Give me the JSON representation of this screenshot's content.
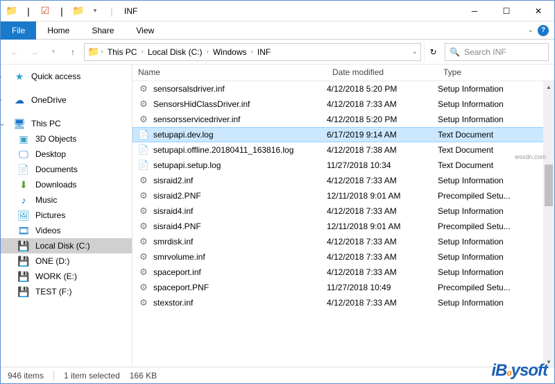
{
  "window": {
    "title": "INF",
    "separator": "|"
  },
  "ribbon": {
    "tabs": [
      "File",
      "Home",
      "Share",
      "View"
    ]
  },
  "breadcrumbs": [
    "This PC",
    "Local Disk (C:)",
    "Windows",
    "INF"
  ],
  "search": {
    "placeholder": "Search INF"
  },
  "sidebar": {
    "quick": "Quick access",
    "onedrive": "OneDrive",
    "thispc": "This PC",
    "items": [
      "3D Objects",
      "Desktop",
      "Documents",
      "Downloads",
      "Music",
      "Pictures",
      "Videos",
      "Local Disk (C:)",
      "ONE (D:)",
      "WORK (E:)",
      "TEST (F:)"
    ]
  },
  "columns": {
    "name": "Name",
    "date": "Date modified",
    "type": "Type"
  },
  "files": [
    {
      "name": "sensorsalsdriver.inf",
      "date": "4/12/2018 5:20 PM",
      "type": "Setup Information",
      "ico": "inf"
    },
    {
      "name": "SensorsHidClassDriver.inf",
      "date": "4/12/2018 7:33 AM",
      "type": "Setup Information",
      "ico": "inf"
    },
    {
      "name": "sensorsservicedriver.inf",
      "date": "4/12/2018 5:20 PM",
      "type": "Setup Information",
      "ico": "inf"
    },
    {
      "name": "setupapi.dev.log",
      "date": "6/17/2019 9:14 AM",
      "type": "Text Document",
      "ico": "log",
      "selected": true
    },
    {
      "name": "setupapi.offline.20180411_163816.log",
      "date": "4/12/2018 7:38 AM",
      "type": "Text Document",
      "ico": "log"
    },
    {
      "name": "setupapi.setup.log",
      "date": "11/27/2018 10:34",
      "type": "Text Document",
      "ico": "log"
    },
    {
      "name": "sisraid2.inf",
      "date": "4/12/2018 7:33 AM",
      "type": "Setup Information",
      "ico": "inf"
    },
    {
      "name": "sisraid2.PNF",
      "date": "12/11/2018 9:01 AM",
      "type": "Precompiled Setu...",
      "ico": "inf"
    },
    {
      "name": "sisraid4.inf",
      "date": "4/12/2018 7:33 AM",
      "type": "Setup Information",
      "ico": "inf"
    },
    {
      "name": "sisraid4.PNF",
      "date": "12/11/2018 9:01 AM",
      "type": "Precompiled Setu...",
      "ico": "inf"
    },
    {
      "name": "smrdisk.inf",
      "date": "4/12/2018 7:33 AM",
      "type": "Setup Information",
      "ico": "inf"
    },
    {
      "name": "smrvolume.inf",
      "date": "4/12/2018 7:33 AM",
      "type": "Setup Information",
      "ico": "inf"
    },
    {
      "name": "spaceport.inf",
      "date": "4/12/2018 7:33 AM",
      "type": "Setup Information",
      "ico": "inf"
    },
    {
      "name": "spaceport.PNF",
      "date": "11/27/2018 10:49",
      "type": "Precompiled Setu...",
      "ico": "inf"
    },
    {
      "name": "stexstor.inf",
      "date": "4/12/2018 7:33 AM",
      "type": "Setup Information",
      "ico": "inf"
    }
  ],
  "status": {
    "count": "946 items",
    "selected": "1 item selected",
    "size": "166 KB"
  },
  "watermark": {
    "text": "iBoysoft",
    "small": "wsxdn.com"
  }
}
